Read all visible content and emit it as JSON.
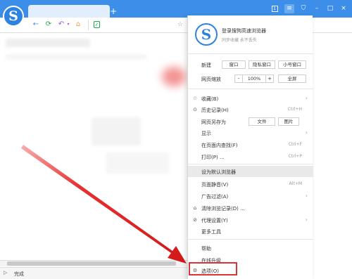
{
  "toolbar": {
    "new_tab": "+",
    "minimize": "–",
    "maximize": "□",
    "close": "×",
    "badge": "1"
  },
  "status": {
    "text": "完成"
  },
  "menu": {
    "account": {
      "title": "登录搜狗高速浏览器",
      "subtitle": "同步收藏 永不丢失"
    },
    "new_row": {
      "label": "新建",
      "window": "窗口",
      "private": "隐私窗口",
      "mini": "小号窗口"
    },
    "zoom_row": {
      "label": "网页缩放",
      "minus": "-",
      "value": "100%",
      "plus": "+",
      "fullscreen": "全屏"
    },
    "saveas_row": {
      "label": "网页另存为",
      "file": "文件",
      "image": "图片"
    },
    "items": [
      {
        "label": "收藏(B)",
        "shortcut": "",
        "icon": "☆"
      },
      {
        "label": "历史记录(H)",
        "shortcut": "Ctrl+H",
        "icon": "⊙"
      },
      {
        "label": "显示",
        "shortcut": "",
        "icon": ""
      },
      {
        "label": "在页面内查找(F)",
        "shortcut": "Ctrl+F",
        "icon": ""
      },
      {
        "label": "打印(P) ...",
        "shortcut": "Ctrl+P",
        "icon": ""
      },
      {
        "label": "设为默认浏览器",
        "shortcut": "",
        "icon": ""
      },
      {
        "label": "页面静音(V)",
        "shortcut": "Alt+M",
        "icon": ""
      },
      {
        "label": "广告过滤(A)",
        "shortcut": "",
        "icon": ""
      },
      {
        "label": "清除浏览记录(D) ...",
        "shortcut": "",
        "icon": "⌂"
      },
      {
        "label": "代理设置(Y)",
        "shortcut": "",
        "icon": "⊘"
      },
      {
        "label": "更多工具",
        "shortcut": "",
        "icon": ""
      },
      {
        "label": "帮助",
        "shortcut": "",
        "icon": ""
      },
      {
        "label": "在线升级",
        "shortcut": "",
        "icon": ""
      },
      {
        "label": "选项(O)",
        "shortcut": "",
        "icon": "⚙"
      }
    ]
  },
  "colors": {
    "accent": "#3d8ee8",
    "highlight_box": "#d9343a",
    "arrow": "#e02020"
  }
}
